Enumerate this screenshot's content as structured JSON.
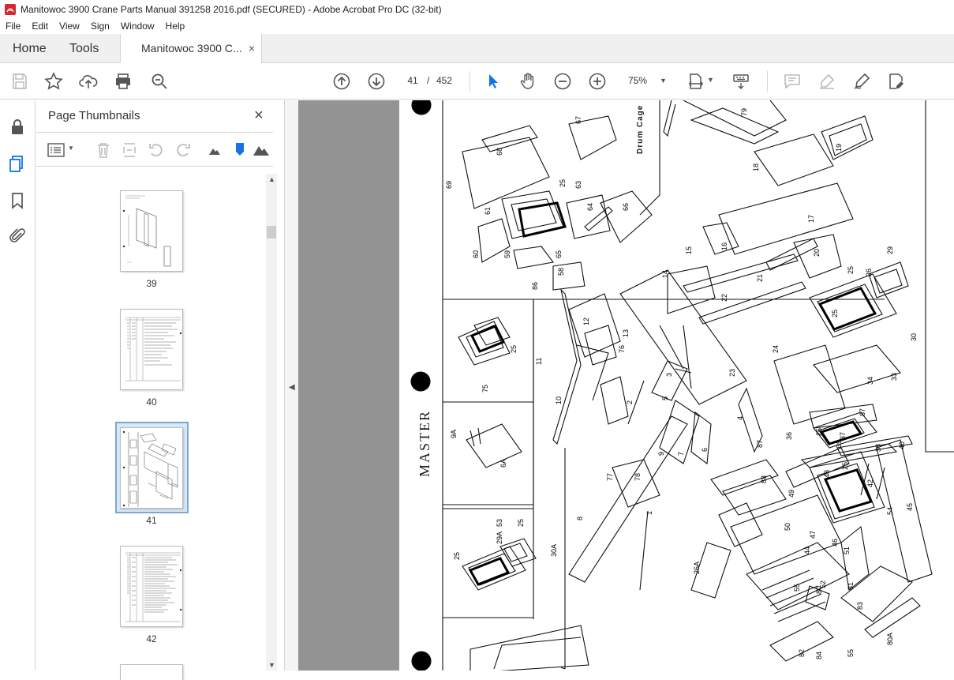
{
  "window": {
    "title": "Manitowoc 3900 Crane Parts Manual 391258 2016.pdf (SECURED) - Adobe Acrobat Pro DC (32-bit)"
  },
  "menu": [
    "File",
    "Edit",
    "View",
    "Sign",
    "Window",
    "Help"
  ],
  "tabs": {
    "home": "Home",
    "tools": "Tools",
    "document": "Manitowoc 3900 C...",
    "close": "×"
  },
  "toolbar": {
    "page_current": "41",
    "page_sep": "/",
    "page_total": "452",
    "zoom": "75%"
  },
  "thumbnails": {
    "title": "Page Thumbnails",
    "close": "×",
    "pages": [
      {
        "label": "39",
        "selected": false
      },
      {
        "label": "40",
        "selected": false
      },
      {
        "label": "41",
        "selected": true
      },
      {
        "label": "42",
        "selected": false
      }
    ]
  },
  "document": {
    "side_text": "MASTER",
    "section_label": "Drum Cage",
    "callouts": [
      "79",
      "67",
      "68",
      "19",
      "18",
      "69",
      "25",
      "63",
      "61",
      "64",
      "66",
      "17",
      "60",
      "59",
      "65",
      "16",
      "15",
      "20",
      "58",
      "86",
      "14",
      "21",
      "29",
      "25",
      "26",
      "22",
      "25",
      "12",
      "11",
      "13",
      "24",
      "30",
      "76",
      "25",
      "75",
      "3",
      "23",
      "10",
      "2",
      "5",
      "4",
      "34",
      "33",
      "87",
      "6A",
      "9A",
      "9",
      "7",
      "6",
      "87",
      "36",
      "25",
      "37",
      "39",
      "38",
      "40",
      "77",
      "78",
      "88",
      "49",
      "48",
      "25",
      "42",
      "8",
      "1",
      "50",
      "47",
      "46",
      "54",
      "44",
      "45",
      "51",
      "26A",
      "25",
      "29A",
      "25",
      "30A",
      "53",
      "52",
      "55",
      "80",
      "81",
      "83",
      "82",
      "84",
      "80A",
      "55"
    ],
    "colors": {
      "viewer_bg": "#939393",
      "selection_blue": "#7aa7d6",
      "accent_blue": "#1473e6"
    }
  }
}
